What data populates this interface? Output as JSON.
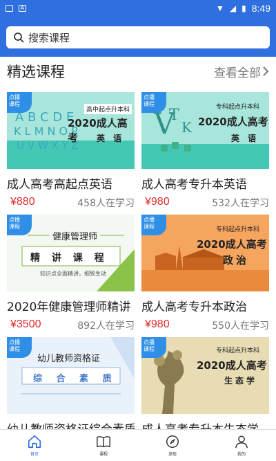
{
  "status_bar": {
    "time": "8:49"
  },
  "search": {
    "placeholder": "搜索课程"
  },
  "section": {
    "title": "精选课程",
    "view_all": "查看全部"
  },
  "courses": [
    {
      "tag": "点播\n课程",
      "thumb_sub": "高中起点升本科",
      "thumb_title": "2020成人高考",
      "thumb_subject": "英 语",
      "title": "成人高考高起点英语",
      "price": "¥880",
      "learners": "458人在学习"
    },
    {
      "tag": "点播\n课程",
      "thumb_sub": "专科起点升本科",
      "thumb_title": "2020成人高考",
      "thumb_subject": "英 语",
      "title": "成人高考专升本英语",
      "price": "¥980",
      "learners": "532人在学习"
    },
    {
      "tag": "点播\n课程",
      "thumb_sub": "知识点全面精讲，细致生动",
      "thumb_title": "健康管理师",
      "thumb_subject": "精 讲 课 程",
      "title": "2020年健康管理师精讲",
      "price": "¥3500",
      "learners": "892人在学习"
    },
    {
      "tag": "点播\n课程",
      "thumb_sub": "专科起点升本科",
      "thumb_title": "2020成人高考",
      "thumb_subject": "政治",
      "title": "成人高考专升本政治",
      "price": "¥980",
      "learners": "550人在学习"
    },
    {
      "tag": "点播\n课程",
      "thumb_sub": "",
      "thumb_title": "幼儿教师资格证",
      "thumb_subject": "综 合 素 质",
      "title": "幼儿教师资格证综合素质",
      "price": "",
      "learners": ""
    },
    {
      "tag": "点播\n课程",
      "thumb_sub": "专科起点升本科",
      "thumb_title": "2020成人高考",
      "thumb_subject": "生态学",
      "title": "成人高考专升本生态学",
      "price": "",
      "learners": ""
    }
  ],
  "bottom_nav": [
    {
      "label": "首页",
      "icon": "home-icon"
    },
    {
      "label": "课程",
      "icon": "book-icon"
    },
    {
      "label": "发现",
      "icon": "discover-icon"
    },
    {
      "label": "我的",
      "icon": "profile-icon"
    }
  ],
  "colors": {
    "accent": "#2f6fe0",
    "price": "#e02a2a",
    "teal_card": "#43c6b8",
    "orange_card": "#f3a25f"
  }
}
